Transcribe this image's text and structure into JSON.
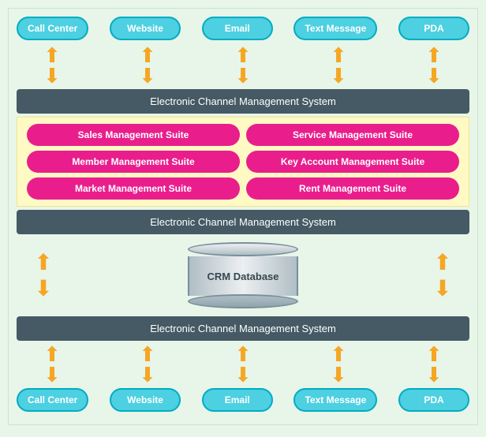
{
  "channels_top": [
    {
      "label": "Call Center"
    },
    {
      "label": "Website"
    },
    {
      "label": "Email"
    },
    {
      "label": "Text Message"
    },
    {
      "label": "PDA"
    }
  ],
  "channels_bottom": [
    {
      "label": "Call Center"
    },
    {
      "label": "Website"
    },
    {
      "label": "Email"
    },
    {
      "label": "Text Message"
    },
    {
      "label": "PDA"
    }
  ],
  "bars": {
    "top": "Electronic Channel Management System",
    "middle": "Electronic Channel Management System",
    "bottom": "Electronic Channel Management System"
  },
  "suites_left": [
    "Sales Management Suite",
    "Member Management Suite",
    "Market Management Suite"
  ],
  "suites_right": [
    "Service Management Suite",
    "Key Account Management Suite",
    "Rent Management Suite"
  ],
  "crm_label": "CRM Database"
}
